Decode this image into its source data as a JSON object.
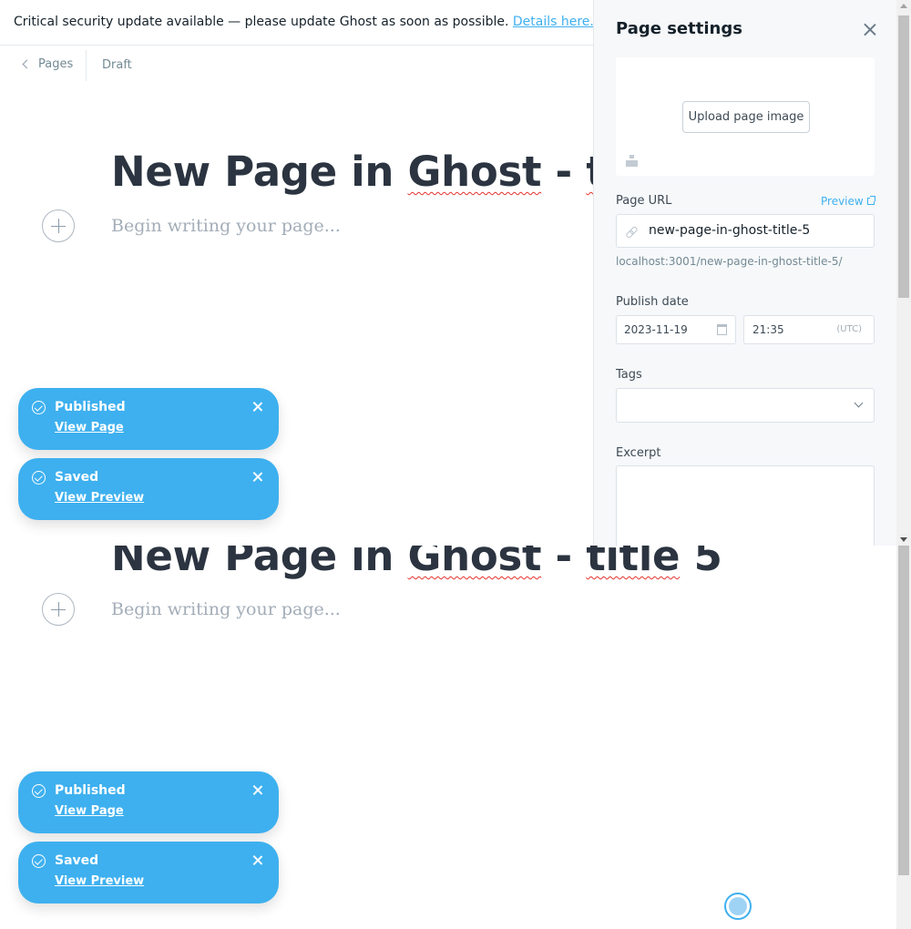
{
  "alert": {
    "message": "Critical security update available — please update Ghost as soon as possible.",
    "link": "Details here."
  },
  "breadcrumb": {
    "back_label": "Pages",
    "status": "Draft"
  },
  "editor": {
    "title_plain": "New Page in ",
    "title_word_ghost": "Ghost",
    "title_dash": " - ",
    "title_word_title": "title",
    "title_number": " 5",
    "body_placeholder": "Begin writing your page..."
  },
  "settings": {
    "title": "Page settings",
    "upload_label": "Upload page image",
    "page_url_label": "Page URL",
    "preview_label": "Preview",
    "url_value": "new-page-in-ghost-title-5",
    "url_full": "localhost:3001/new-page-in-ghost-title-5/",
    "publish_date_label": "Publish date",
    "date_value": "2023-11-19",
    "time_value": "21:35",
    "timezone": "(UTC)",
    "tags_label": "Tags",
    "excerpt_label": "Excerpt"
  },
  "toasts": [
    {
      "title": "Published",
      "link": "View Page"
    },
    {
      "title": "Saved",
      "link": "View Preview"
    }
  ],
  "colors": {
    "accent": "#3eb0ef",
    "toast_bg": "#3eb0ef",
    "panel_bg": "#f6f8fa"
  }
}
